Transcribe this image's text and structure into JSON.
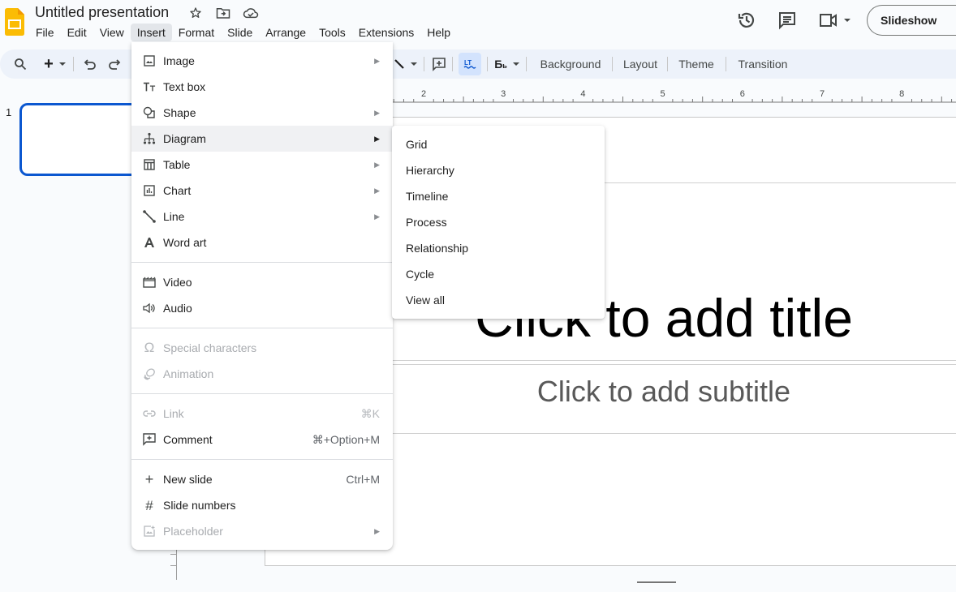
{
  "app": {
    "doc_title": "Untitled presentation",
    "brand_color": "#fbbc04",
    "accent_color": "#0b57d0"
  },
  "menubar": [
    "File",
    "Edit",
    "View",
    "Insert",
    "Format",
    "Slide",
    "Arrange",
    "Tools",
    "Extensions",
    "Help"
  ],
  "menubar_active": "Insert",
  "header_right": {
    "icons": [
      "version-history-icon",
      "comments-icon",
      "meet-icon"
    ],
    "slideshow_label": "Slideshow"
  },
  "toolbar": {
    "icons": [
      "search-icon",
      "new-slide-icon",
      "undo-icon",
      "redo-icon",
      "line-icon",
      "comment-icon",
      "spellcheck-icon",
      "format-options-icon"
    ],
    "buttons": [
      "Background",
      "Layout",
      "Theme",
      "Transition"
    ]
  },
  "filmstrip": {
    "slides": [
      {
        "number": "1"
      }
    ]
  },
  "ruler": {
    "labels": [
      "2",
      "3",
      "4",
      "5",
      "6",
      "7",
      "8"
    ]
  },
  "slide": {
    "title_placeholder": "Click to add title",
    "subtitle_placeholder": "Click to add subtitle"
  },
  "insert_menu": {
    "groups": [
      [
        {
          "label": "Image",
          "icon": "image-icon",
          "submenu": true
        },
        {
          "label": "Text box",
          "icon": "text-box-icon"
        },
        {
          "label": "Shape",
          "icon": "shape-icon",
          "submenu": true
        },
        {
          "label": "Diagram",
          "icon": "diagram-icon",
          "submenu": true,
          "hover": true
        },
        {
          "label": "Table",
          "icon": "table-icon",
          "submenu": true
        },
        {
          "label": "Chart",
          "icon": "chart-icon",
          "submenu": true
        },
        {
          "label": "Line",
          "icon": "line-icon",
          "submenu": true
        },
        {
          "label": "Word art",
          "icon": "word-art-icon"
        }
      ],
      [
        {
          "label": "Video",
          "icon": "video-icon"
        },
        {
          "label": "Audio",
          "icon": "audio-icon"
        }
      ],
      [
        {
          "label": "Special characters",
          "icon": "omega-icon",
          "disabled": true
        },
        {
          "label": "Animation",
          "icon": "animation-icon",
          "disabled": true
        }
      ],
      [
        {
          "label": "Link",
          "icon": "link-icon",
          "disabled": true,
          "shortcut": "⌘K"
        },
        {
          "label": "Comment",
          "icon": "add-comment-icon",
          "shortcut": "⌘+Option+M"
        }
      ],
      [
        {
          "label": "New slide",
          "icon": "plus-icon",
          "shortcut": "Ctrl+M"
        },
        {
          "label": "Slide numbers",
          "icon": "hash-icon"
        },
        {
          "label": "Placeholder",
          "icon": "placeholder-icon",
          "disabled": true,
          "submenu": true
        }
      ]
    ]
  },
  "diagram_submenu": {
    "items": [
      "Grid",
      "Hierarchy",
      "Timeline",
      "Process",
      "Relationship",
      "Cycle",
      "View all"
    ]
  }
}
